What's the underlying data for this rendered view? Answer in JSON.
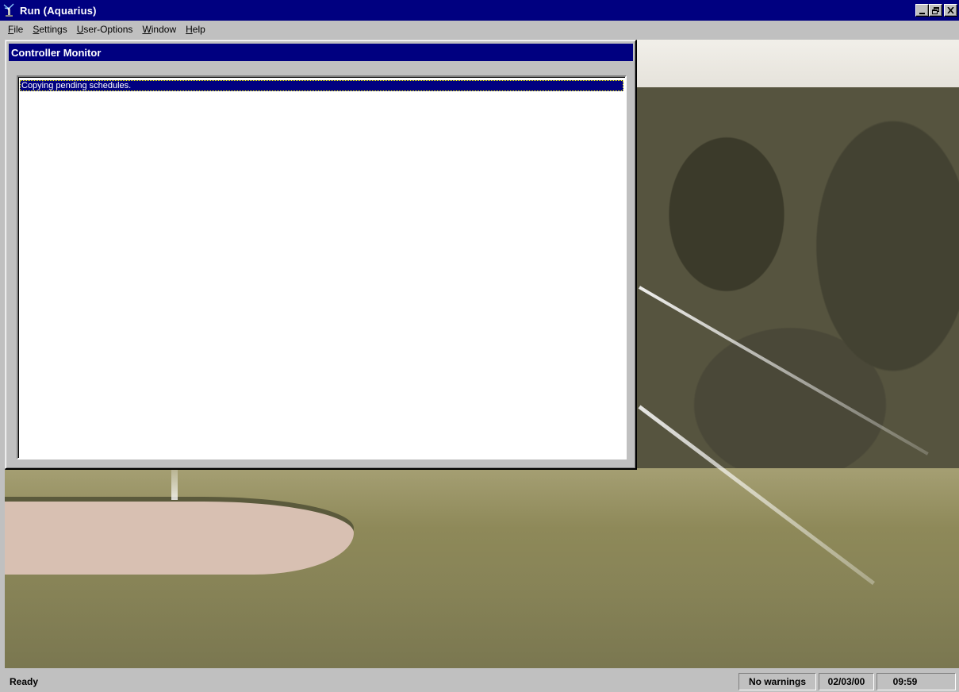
{
  "window": {
    "title": "Run (Aquarius)",
    "controls": {
      "minimize": "_",
      "restore": "🗗",
      "close": "✕"
    }
  },
  "menu": [
    {
      "label": "File",
      "key": "F",
      "rest": "ile"
    },
    {
      "label": "Settings",
      "key": "S",
      "rest": "ettings"
    },
    {
      "label": "User-Options",
      "key": "U",
      "rest": "ser-Options"
    },
    {
      "label": "Window",
      "key": "W",
      "rest": "indow"
    },
    {
      "label": "Help",
      "key": "H",
      "rest": "elp"
    }
  ],
  "child_window": {
    "title": "Controller Monitor",
    "log": [
      "Copying pending schedules."
    ]
  },
  "status": {
    "ready": "Ready",
    "warnings": "No warnings",
    "date": "02/03/00",
    "time": "09:59"
  },
  "colors": {
    "title_bar": "#000080",
    "face": "#c0c0c0"
  }
}
